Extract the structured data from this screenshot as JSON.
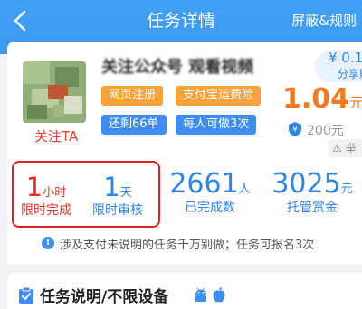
{
  "nav": {
    "title": "任务详情",
    "right_action": "屏蔽&规则"
  },
  "task": {
    "follow_label": "关注TA",
    "title": "关注公众号 观看视频",
    "tags": [
      "网页注册",
      "支付宝运费险",
      "还剩66单",
      "每人可做3次"
    ],
    "reward_amount": "¥ 0.1",
    "reward_label": "分享赚",
    "price": "1.04",
    "price_unit": "元",
    "deposit": "200元",
    "report_label": "⚠ 举"
  },
  "stats": [
    {
      "value": "1",
      "unit": "小时",
      "label": "限时完成"
    },
    {
      "value": "1",
      "unit": "天",
      "label": "限时审核"
    },
    {
      "value": "2661",
      "unit": "人",
      "label": "已完成数"
    },
    {
      "value": "3025",
      "unit": "元",
      "label": "托管赏金"
    }
  ],
  "notice": "涉及支付未说明的任务千万别做；任务可报名3次",
  "section": {
    "title": "任务说明/不限设备"
  },
  "colors": {
    "nav_blue": "#3c98f0",
    "accent_red": "#e8332c",
    "accent_blue": "#2f86e6",
    "price_orange": "#f47a1f",
    "tag_orange": "#f7a23b",
    "tag_blue": "#3d8ef0"
  },
  "icons": [
    "back-arrow-icon",
    "shield-icon",
    "info-icon",
    "clipboard-check-icon",
    "android-icon",
    "apple-icon"
  ]
}
